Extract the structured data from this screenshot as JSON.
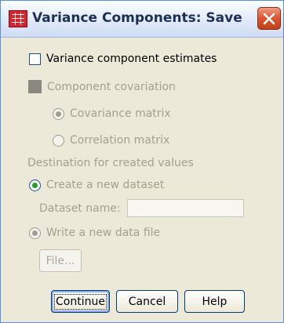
{
  "window": {
    "title": "Variance Components: Save"
  },
  "options": {
    "variance_estimates": "Variance component estimates",
    "component_covariation": "Component covariation",
    "covariance_matrix": "Covariance matrix",
    "correlation_matrix": "Correlation matrix"
  },
  "destination": {
    "heading": "Destination for created values",
    "create_dataset": "Create a new dataset",
    "dataset_name_label": "Dataset name:",
    "dataset_name_value": "",
    "write_file": "Write a new data file",
    "file_button": "File..."
  },
  "buttons": {
    "continue": "Continue",
    "cancel": "Cancel",
    "help": "Help"
  },
  "colors": {
    "title_close": "#d9542f",
    "radio_selected": "#21a121",
    "accent_border": "#5a8ee0"
  }
}
